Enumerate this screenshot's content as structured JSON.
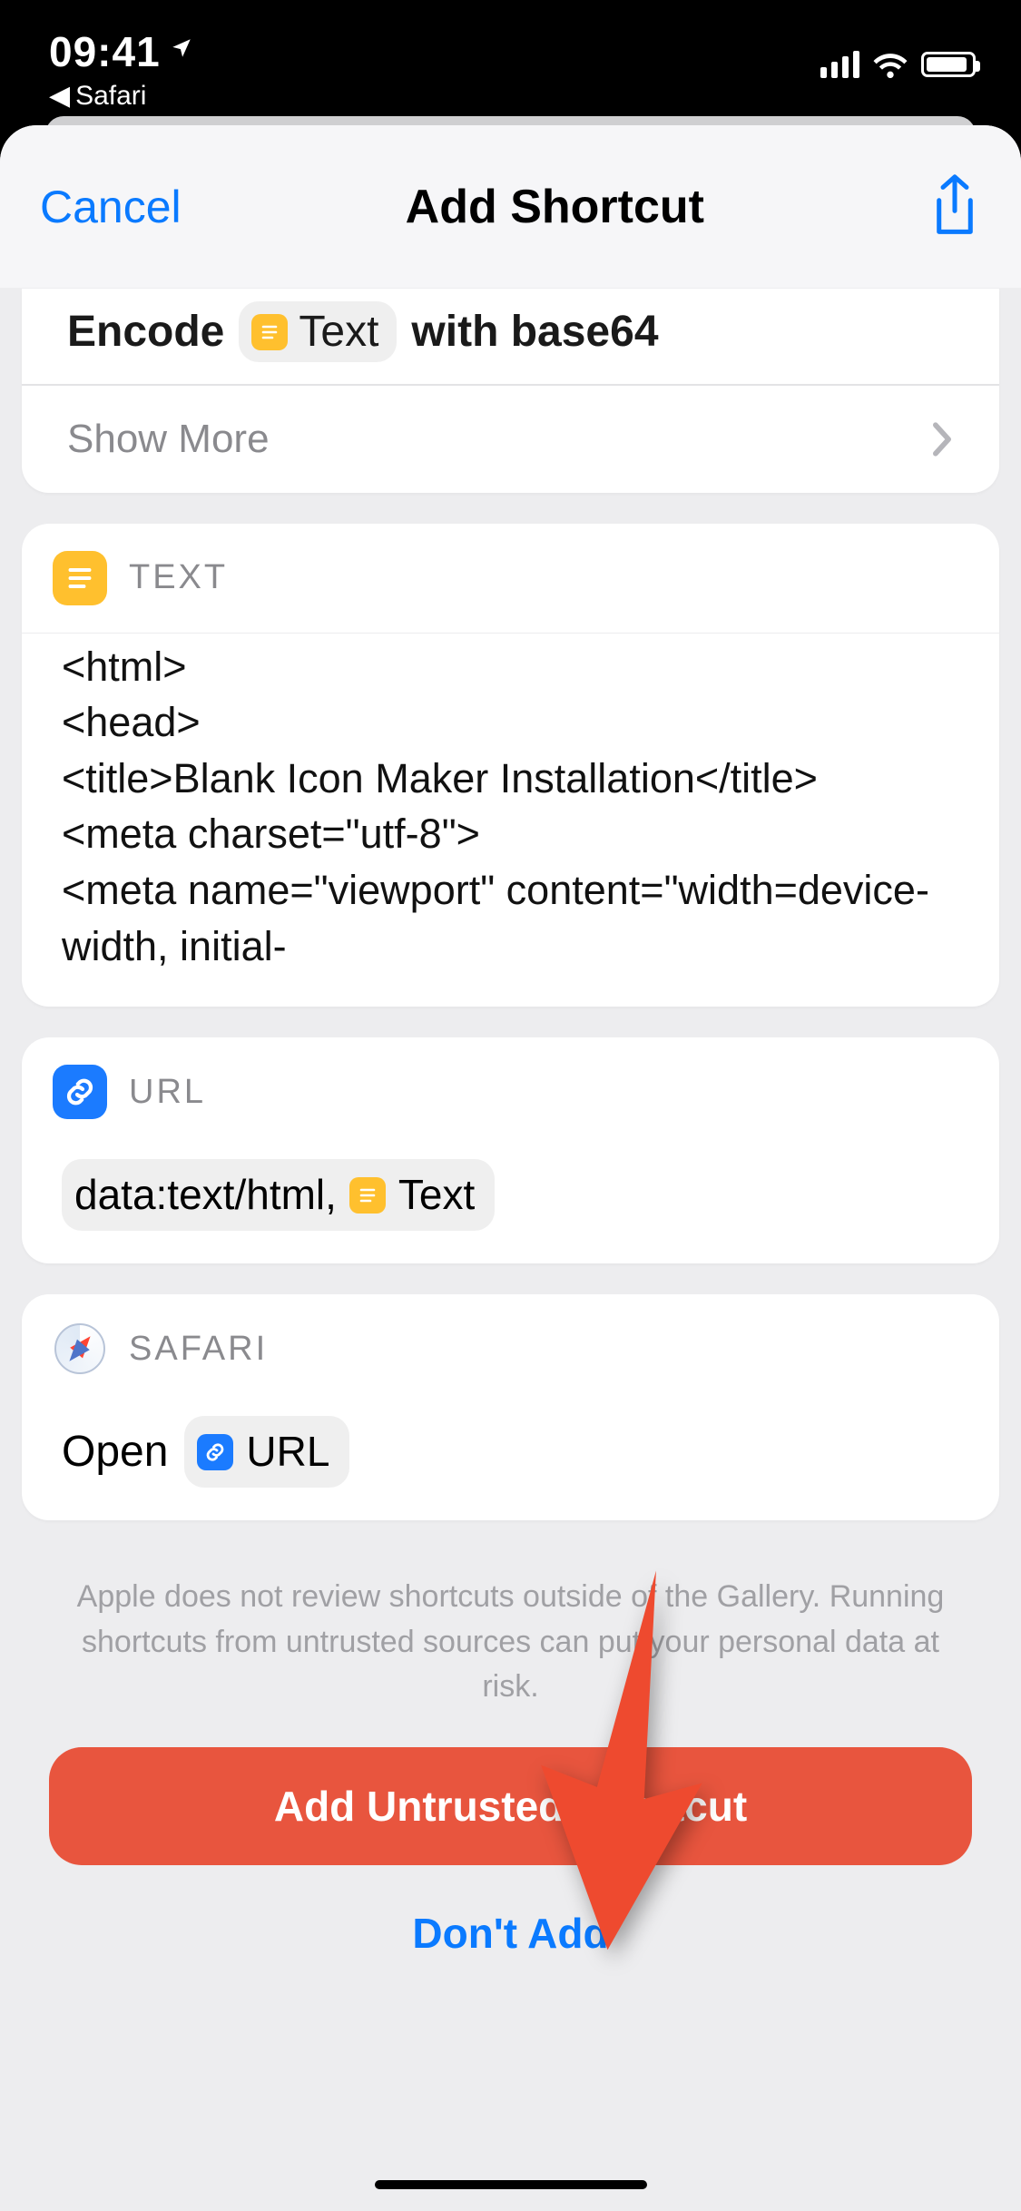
{
  "status": {
    "time": "09:41",
    "back_app": "Safari"
  },
  "nav": {
    "cancel": "Cancel",
    "title": "Add Shortcut"
  },
  "actions": {
    "encode": {
      "prefix": "Encode",
      "token": "Text",
      "suffix": "with base64"
    },
    "show_more": "Show More",
    "text_block": {
      "header": "TEXT",
      "body": "<html>\n<head>\n<title>Blank Icon Maker Installation</title>\n<meta charset=\"utf-8\">\n<meta name=\"viewport\" content=\"width=device-width, initial-"
    },
    "url_block": {
      "header": "URL",
      "prefix": "data:text/html,",
      "token": "Text"
    },
    "safari_block": {
      "header": "SAFARI",
      "prefix": "Open",
      "token": "URL"
    }
  },
  "warning": "Apple does not review shortcuts outside of the Gallery. Running shortcuts from untrusted sources can put your personal data at risk.",
  "buttons": {
    "primary": "Add Untrusted Shortcut",
    "secondary": "Don't Add"
  }
}
